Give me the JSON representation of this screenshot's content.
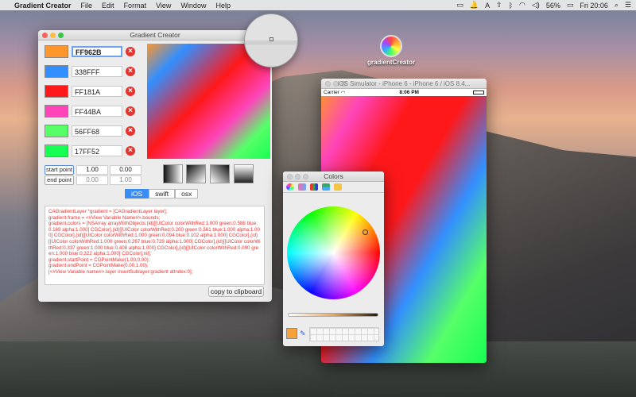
{
  "menubar": {
    "apple": "",
    "app_name": "Gradient Creator",
    "items": [
      "File",
      "Edit",
      "Format",
      "View",
      "Window",
      "Help"
    ],
    "battery": "56%",
    "clock": "Fri 20:06"
  },
  "desktop_icon": {
    "label": "gradientCreator"
  },
  "gradient_creator": {
    "title": "Gradient Creator",
    "colors": [
      {
        "hex": "FF962B",
        "color": "#FF962B"
      },
      {
        "hex": "338FFF",
        "color": "#338FFF"
      },
      {
        "hex": "FF181A",
        "color": "#FF181A"
      },
      {
        "hex": "FF44BA",
        "color": "#FF44BA"
      },
      {
        "hex": "56FF68",
        "color": "#56FF68"
      },
      {
        "hex": "17FF52",
        "color": "#17FF52"
      }
    ],
    "start_point": {
      "label": "start point",
      "x": "1.00",
      "y": "0.00"
    },
    "end_point": {
      "label": "end point",
      "x": "0.00",
      "y": "1.00"
    },
    "tabs": [
      "iOS",
      "swift",
      "osx"
    ],
    "selected_tab": "iOS",
    "code_lines": [
      "CAGradientLayer *gradient = [CAGradientLayer layer];",
      "gradient.frame = <#View Variable Name#>.bounds;",
      "gradient.colors = [NSArray arrayWithObjects:(id)[[UIColor colorWithRed:1.000 green:0.588 blue:0.169 alpha:1.000] CGColor],(id)[[UIColor colorWithRed:0.200 green:0.561 blue:1.000 alpha:1.000] CGColor],(id)[[UIColor colorWithRed:1.000 green:0.094 blue:0.102 alpha:1.000] CGColor],(id)[[UIColor colorWithRed:1.000 green:0.267 blue:0.729 alpha:1.000] CGColor],(id)[[UIColor colorWithRed:0.337 green:1.000 blue:0.408 alpha:1.000] CGColor],(id)[[UIColor colorWithRed:0.090 green:1.000 blue:0.322 alpha:1.000] CGColor],nil];",
      "gradient.startPoint = CGPointMake(1.00,0.00);",
      "gradient.endPoint = CGPointMake(0.00,1.00);",
      "[<#View Variable name#>.layer insertSublayer:gradient atIndex:0];"
    ],
    "copy_button": "copy to clipboard"
  },
  "simulator": {
    "title": "iOS Simulator - iPhone 6 - iPhone 6 / iOS 8.4...",
    "carrier": "Carrier",
    "time": "8:06 PM"
  },
  "colors_panel": {
    "title": "Colors",
    "current_color": "#F7A13A"
  }
}
